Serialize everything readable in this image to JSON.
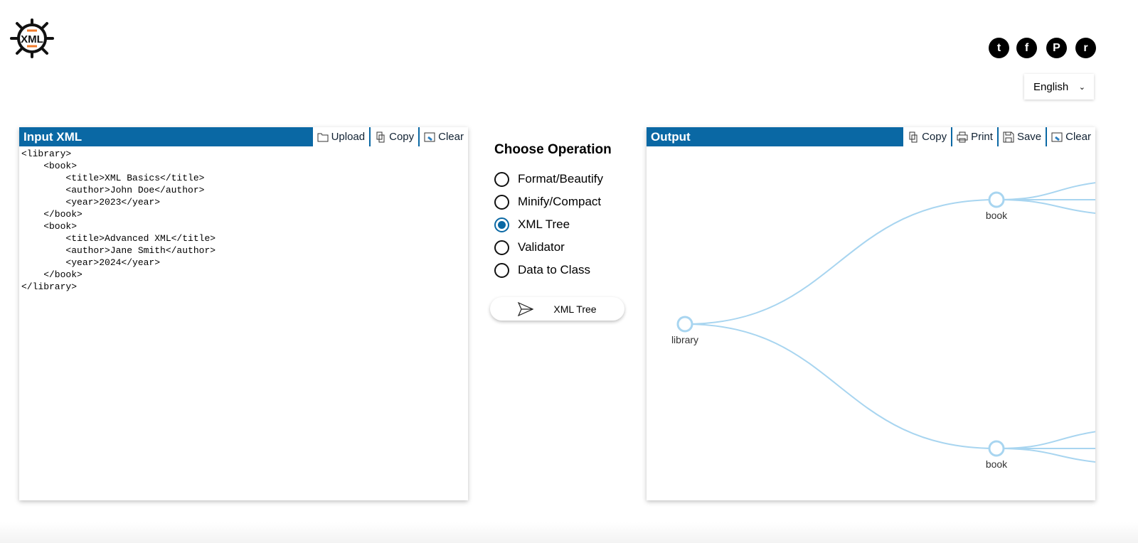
{
  "logo": {
    "text": "XML"
  },
  "social": [
    {
      "icon": "twitter-icon",
      "glyph": "t"
    },
    {
      "icon": "facebook-icon",
      "glyph": "f"
    },
    {
      "icon": "pinterest-icon",
      "glyph": "P"
    },
    {
      "icon": "reddit-icon",
      "glyph": "r"
    }
  ],
  "language": {
    "selected": "English"
  },
  "input": {
    "title": "Input XML",
    "buttons": [
      "Upload",
      "Copy",
      "Clear"
    ],
    "content": "<library>\n    <book>\n        <title>XML Basics</title>\n        <author>John Doe</author>\n        <year>2023</year>\n    </book>\n    <book>\n        <title>Advanced XML</title>\n        <author>Jane Smith</author>\n        <year>2024</year>\n    </book>\n</library>"
  },
  "operations": {
    "title": "Choose Operation",
    "options": [
      "Format/Beautify",
      "Minify/Compact",
      "XML Tree",
      "Validator",
      "Data to Class"
    ],
    "selected": "XML Tree",
    "run_label": "XML Tree"
  },
  "output": {
    "title": "Output",
    "buttons": [
      "Copy",
      "Print",
      "Save",
      "Clear"
    ],
    "tree": {
      "root": "library",
      "children": [
        "book",
        "book"
      ]
    }
  },
  "colors": {
    "accent": "#0a68a4",
    "tree_link": "#a8d5f0"
  }
}
